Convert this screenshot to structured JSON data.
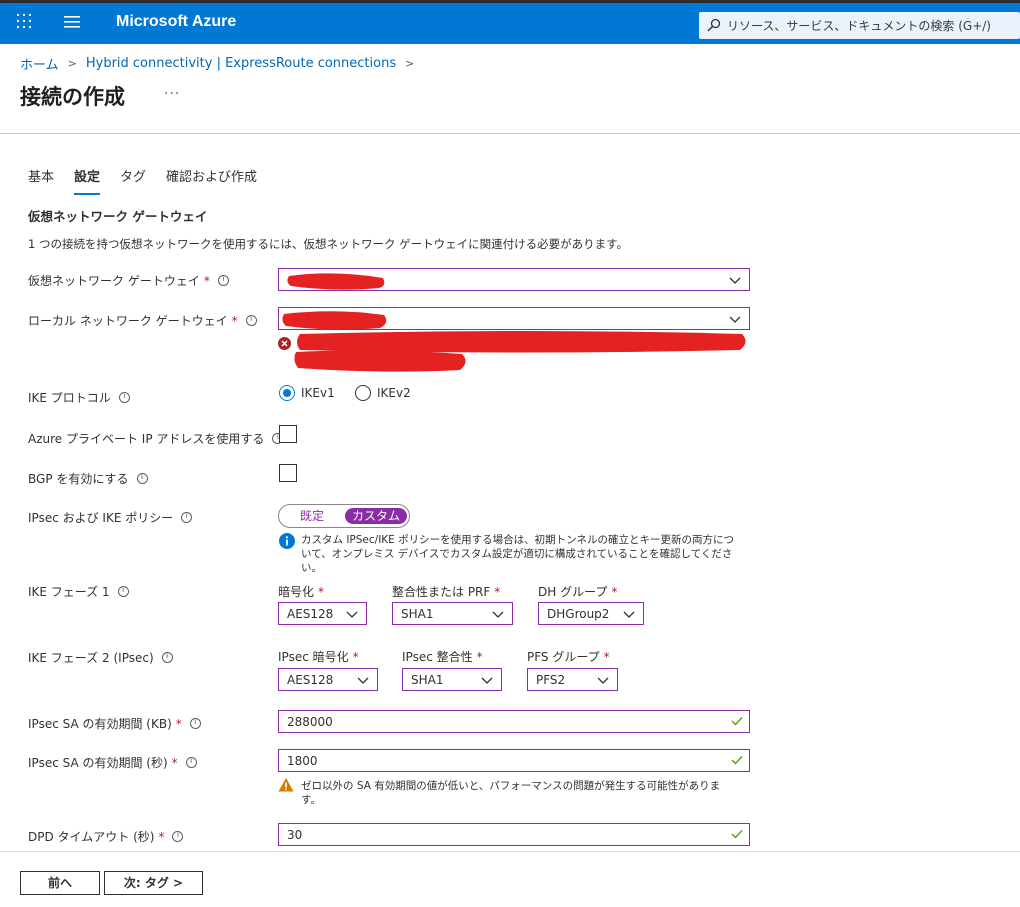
{
  "app": {
    "brand": "Microsoft Azure",
    "search_placeholder": "リソース、サービス、ドキュメントの検索 (G+/)"
  },
  "breadcrumb": [
    "ホーム",
    "Hybrid connectivity | ExpressRoute connections"
  ],
  "page": {
    "title": "接続の作成",
    "more": "···"
  },
  "tabs": [
    "基本",
    "設定",
    "タグ",
    "確認および作成"
  ],
  "active_tab": "設定",
  "section": {
    "title": "仮想ネットワーク ゲートウェイ",
    "desc": "1 つの接続を持つ仮想ネットワークを使用するには、仮想ネットワーク ゲートウェイに関連付ける必要があります。"
  },
  "fields": {
    "vng_label": "仮想ネットワーク ゲートウェイ",
    "lng_label": "ローカル ネットワーク ゲートウェイ",
    "ike_protocol_label": "IKE プロトコル",
    "ike_options": [
      "IKEv1",
      "IKEv2"
    ],
    "ike_selected": "IKEv1",
    "private_ip_label": "Azure プライベート IP アドレスを使用する",
    "private_ip_checked": false,
    "bgp_label": "BGP を有効にする",
    "bgp_checked": false,
    "policy_label": "IPsec および IKE ポリシー",
    "policy_options": [
      "既定",
      "カスタム"
    ],
    "policy_selected": "カスタム",
    "policy_note": "カスタム IPSec/IKE ポリシーを使用する場合は、初期トンネルの確立とキー更新の両方について、オンプレミス デバイスでカスタム設定が適切に構成されていることを確認してください。",
    "phase1_label": "IKE フェーズ 1",
    "phase1": {
      "enc_label": "暗号化",
      "enc_value": "AES128",
      "integ_label": "整合性または PRF",
      "integ_value": "SHA1",
      "dh_label": "DH グループ",
      "dh_value": "DHGroup2"
    },
    "phase2_label": "IKE フェーズ 2 (IPsec)",
    "phase2": {
      "enc_label": "IPsec 暗号化",
      "enc_value": "AES128",
      "integ_label": "IPsec 整合性",
      "integ_value": "SHA1",
      "pfs_label": "PFS グループ",
      "pfs_value": "PFS2"
    },
    "sa_kb_label": "IPsec SA の有効期間 (KB)",
    "sa_kb_value": "288000",
    "sa_sec_label": "IPsec SA の有効期間 (秒)",
    "sa_sec_value": "1800",
    "sa_warning": "ゼロ以外の SA 有効期間の値が低いと、パフォーマンスの問題が発生する可能性があります。",
    "dpd_label": "DPD タイムアウト (秒)",
    "dpd_value": "30"
  },
  "footer": {
    "prev": "前へ",
    "next": "次: タグ >"
  },
  "colors": {
    "azure_blue": "#0078d4",
    "accent_purple": "#8a2da5",
    "required_red": "#a4262c",
    "redaction": "#e52222"
  }
}
